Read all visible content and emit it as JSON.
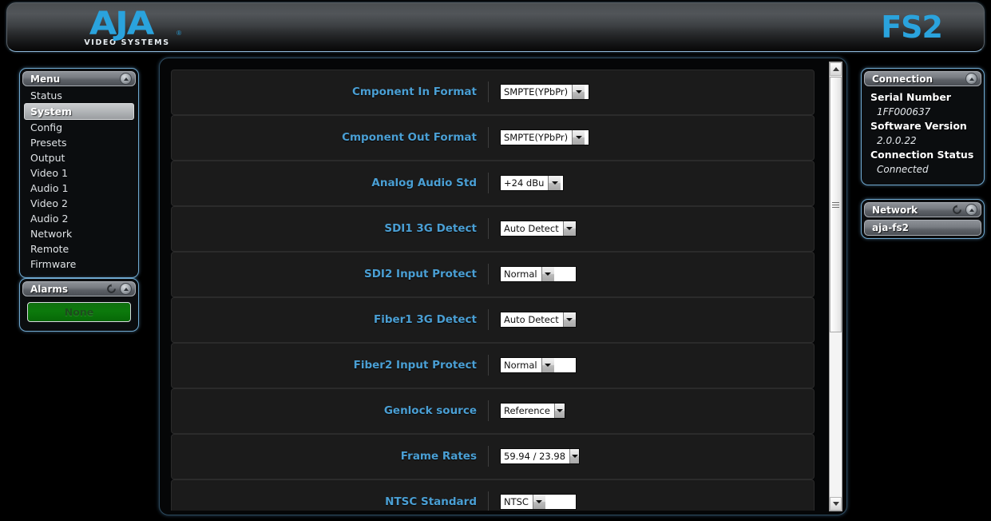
{
  "header": {
    "logo_text": "AJA",
    "logo_tagline": "VIDEO SYSTEMS",
    "logo_registered": "®",
    "model": "FS2",
    "accent_color": "#2aa3dd"
  },
  "menu": {
    "title": "Menu",
    "collapse_icon": "chevron-up-icon",
    "items": [
      {
        "label": "Status",
        "selected": false
      },
      {
        "label": "System",
        "selected": true
      },
      {
        "label": "Config",
        "selected": false
      },
      {
        "label": "Presets",
        "selected": false
      },
      {
        "label": "Output",
        "selected": false
      },
      {
        "label": "Video 1",
        "selected": false
      },
      {
        "label": "Audio 1",
        "selected": false
      },
      {
        "label": "Video 2",
        "selected": false
      },
      {
        "label": "Audio 2",
        "selected": false
      },
      {
        "label": "Network",
        "selected": false
      },
      {
        "label": "Remote",
        "selected": false
      },
      {
        "label": "Firmware",
        "selected": false
      }
    ]
  },
  "alarms": {
    "title": "Alarms",
    "refresh_icon": "refresh-icon",
    "collapse_icon": "chevron-up-icon",
    "status_label": "None",
    "status_color": "#0c7a0c"
  },
  "connection": {
    "title": "Connection",
    "collapse_icon": "chevron-up-icon",
    "fields": [
      {
        "label": "Serial Number",
        "value": "1FF000637"
      },
      {
        "label": "Software Version",
        "value": "2.0.0.22"
      },
      {
        "label": "Connection Status",
        "value": "Connected"
      }
    ]
  },
  "network": {
    "title": "Network",
    "refresh_icon": "refresh-icon",
    "collapse_icon": "chevron-up-icon",
    "devices": [
      {
        "label": "aja-fs2",
        "selected": true
      }
    ]
  },
  "settings": {
    "rows": [
      {
        "label": "Cmponent In Format",
        "value": "SMPTE(YPbPr)",
        "width": 112
      },
      {
        "label": "Cmponent Out Format",
        "value": "SMPTE(YPbPr)",
        "width": 112
      },
      {
        "label": "Analog Audio Std",
        "value": "+24 dBu",
        "width": 80
      },
      {
        "label": "SDI1 3G Detect",
        "value": "Auto Detect",
        "width": 96
      },
      {
        "label": "SDI2 Input Protect",
        "value": "Normal",
        "width": 96
      },
      {
        "label": "Fiber1 3G Detect",
        "value": "Auto Detect",
        "width": 96
      },
      {
        "label": "Fiber2 Input Protect",
        "value": "Normal",
        "width": 96
      },
      {
        "label": "Genlock source",
        "value": "Reference",
        "width": 82
      },
      {
        "label": "Frame Rates",
        "value": "59.94 / 23.98",
        "width": 100
      },
      {
        "label": "NTSC Standard",
        "value": "NTSC",
        "width": 96
      }
    ],
    "label_color": "#4a9fd4"
  },
  "scrollbar": {
    "up_icon": "triangle-up-icon",
    "down_icon": "triangle-down-icon",
    "thumb_name": "scroll-thumb"
  }
}
